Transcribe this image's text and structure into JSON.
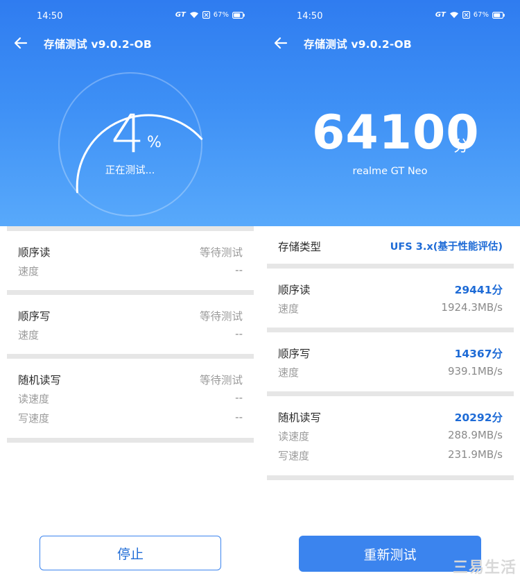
{
  "status_bar": {
    "time": "14:50",
    "network": "GT",
    "battery": "67%"
  },
  "left": {
    "title": "存储测试 v9.0.2-OB",
    "progress_value": "4",
    "progress_unit": "%",
    "progress_fraction": 0.04,
    "status_text": "正在测试...",
    "sections": {
      "seq_read": {
        "label": "顺序读",
        "status": "等待测试",
        "speed_label": "速度",
        "speed_value": "--"
      },
      "seq_write": {
        "label": "顺序写",
        "status": "等待测试",
        "speed_label": "速度",
        "speed_value": "--"
      },
      "random_rw": {
        "label": "随机读写",
        "status": "等待测试",
        "read_label": "读速度",
        "read_value": "--",
        "write_label": "写速度",
        "write_value": "--"
      }
    },
    "stop_button": "停止"
  },
  "right": {
    "title": "存储测试 v9.0.2-OB",
    "score": "64100",
    "score_unit": "分",
    "device": "realme GT Neo",
    "storage_type_label": "存储类型",
    "storage_type_value": "UFS 3.x(基于性能评估)",
    "sections": {
      "seq_read": {
        "label": "顺序读",
        "score": "29441分",
        "speed_label": "速度",
        "speed_value": "1924.3MB/s"
      },
      "seq_write": {
        "label": "顺序写",
        "score": "14367分",
        "speed_label": "速度",
        "speed_value": "939.1MB/s"
      },
      "random_rw": {
        "label": "随机读写",
        "score": "20292分",
        "read_label": "读速度",
        "read_value": "288.9MB/s",
        "write_label": "写速度",
        "write_value": "231.9MB/s"
      }
    },
    "retest_button": "重新测试"
  },
  "watermark": "三易生活",
  "colors": {
    "header_top": "#2f7cf0",
    "header_bottom": "#58a9fb",
    "accent": "#1e6bd6",
    "button": "#3b84ee",
    "divider": "#e6e6e6"
  },
  "icons": [
    "back-arrow-icon",
    "wifi-icon",
    "sim-disabled-icon",
    "battery-icon"
  ]
}
